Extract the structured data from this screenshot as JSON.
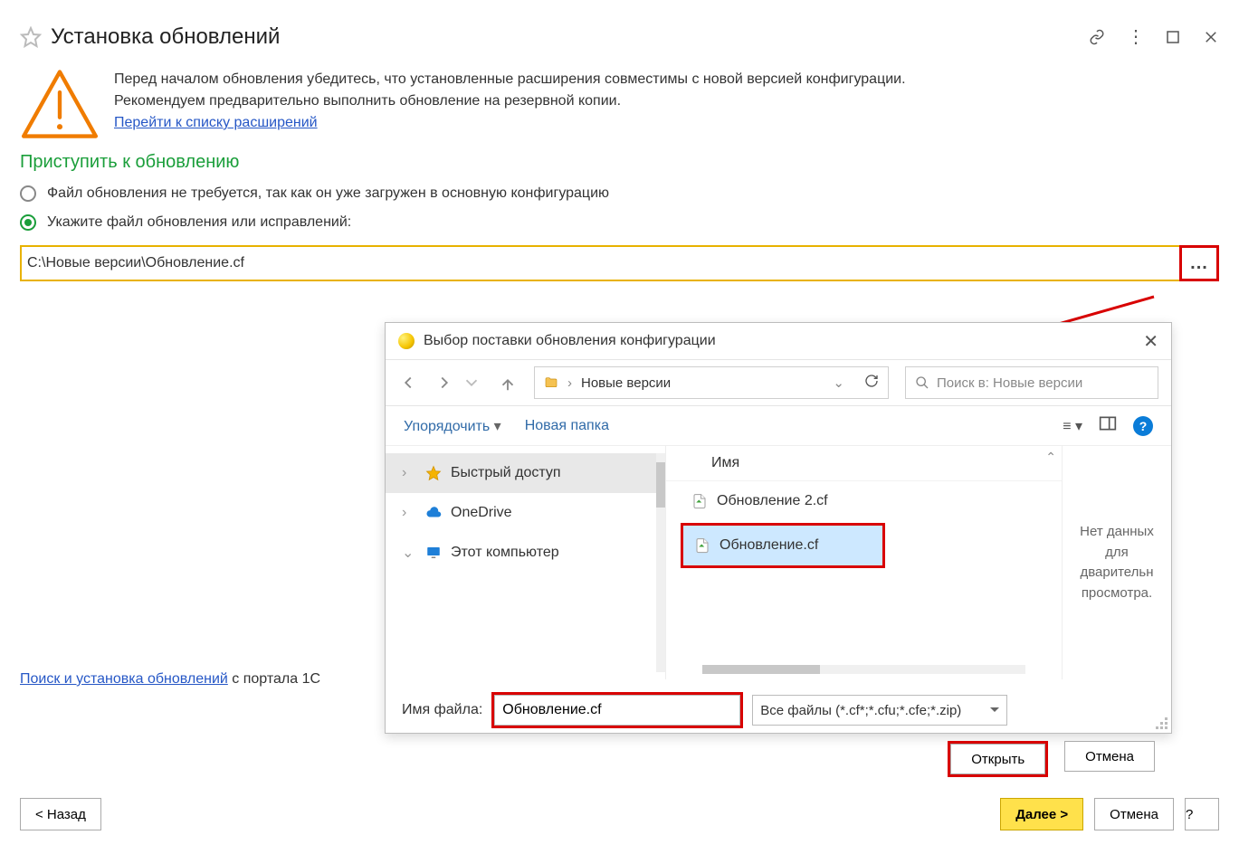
{
  "header": {
    "title": "Установка обновлений"
  },
  "warning": {
    "line1": "Перед началом обновления убедитесь, что установленные расширения совместимы с новой версией конфигурации.",
    "line2": "Рекомендуем предварительно выполнить обновление на резервной копии.",
    "link": "Перейти к списку расширений"
  },
  "section_heading": "Приступить к обновлению",
  "radio": {
    "opt_not_needed": "Файл обновления не требуется, так как он уже загружен в основную конфигурацию",
    "opt_specify": "Укажите файл обновления или исправлений:",
    "selected": 1
  },
  "path_input": {
    "value": "C:\\Новые версии\\Обновление.cf",
    "browse_glyph": "..."
  },
  "portal": {
    "link_label": "Поиск и установка обновлений",
    "suffix": " с портала 1С"
  },
  "footer_buttons": {
    "back": "< Назад",
    "next": "Далее >",
    "cancel": "Отмена",
    "help": "?"
  },
  "dialog": {
    "title": "Выбор поставки обновления конфигурации",
    "path_crumb": "Новые версии",
    "search_placeholder": "Поиск в: Новые версии",
    "toolbar": {
      "organize": "Упорядочить",
      "new_folder": "Новая папка"
    },
    "tree": {
      "quick_access": "Быстрый доступ",
      "onedrive": "OneDrive",
      "this_pc": "Этот компьютер"
    },
    "column_name": "Имя",
    "files": [
      {
        "name": "Обновление 2.cf",
        "selected": false
      },
      {
        "name": "Обновление.cf",
        "selected": true
      }
    ],
    "preview_text": "Нет данных для дварительн просмотра.",
    "filename_label": "Имя файла:",
    "filename_value": "Обновление.cf",
    "filetype": "Все файлы (*.cf*;*.cfu;*.cfe;*.zip)",
    "open": "Открыть",
    "cancel": "Отмена"
  }
}
